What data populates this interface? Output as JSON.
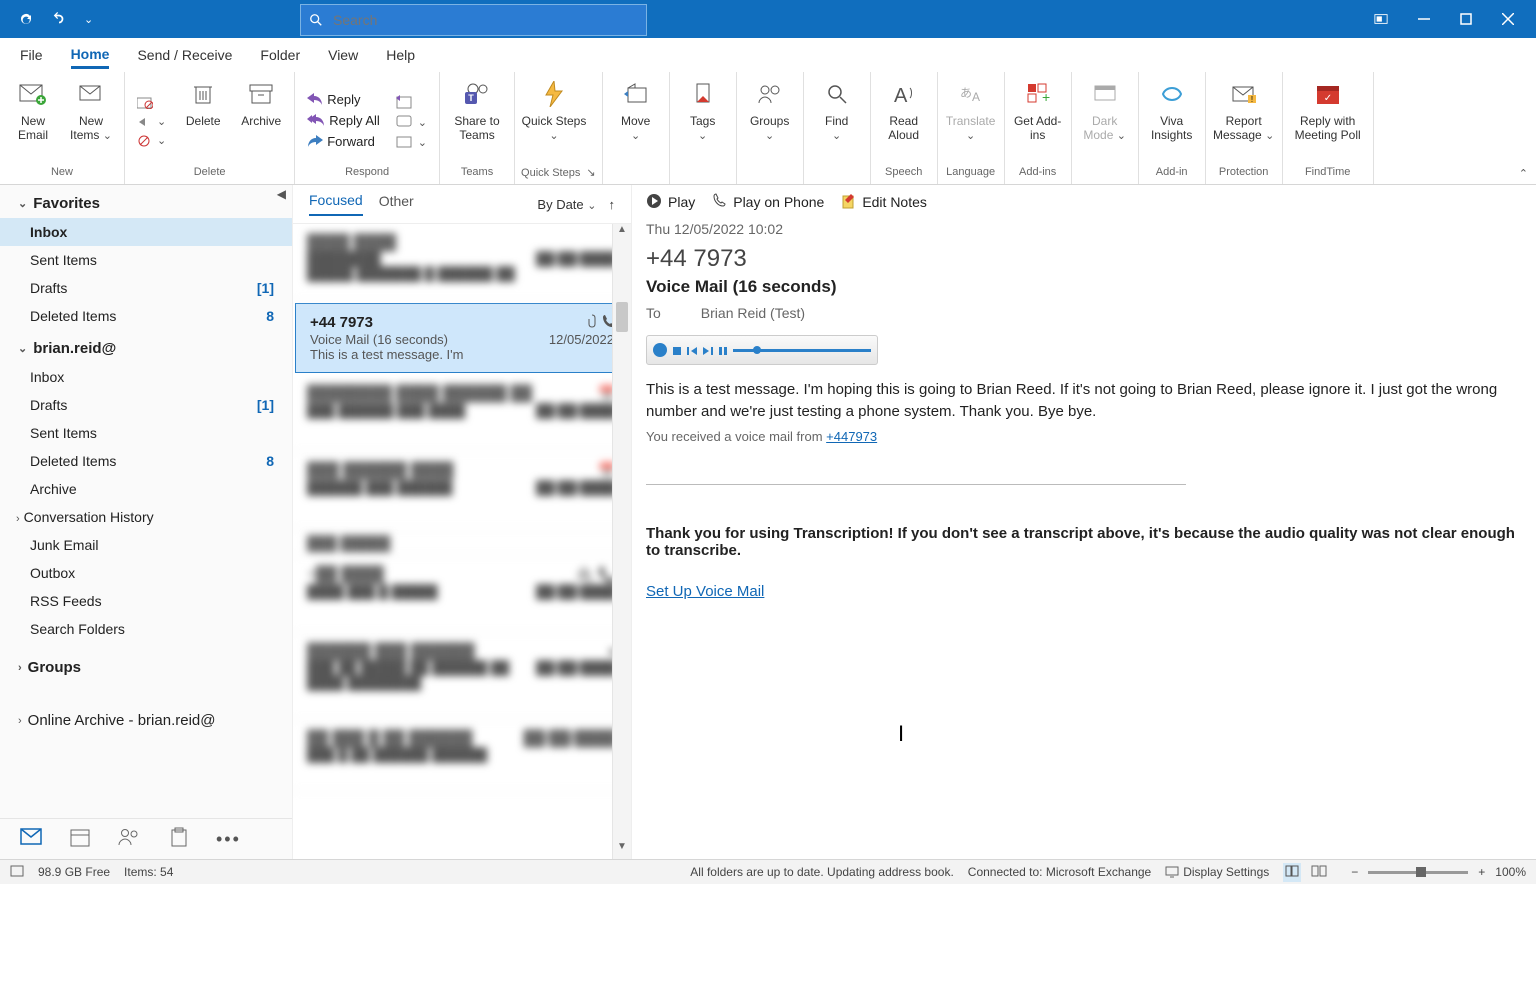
{
  "search_placeholder": "Search",
  "menu_tabs": [
    "File",
    "Home",
    "Send / Receive",
    "Folder",
    "View",
    "Help"
  ],
  "menu_active": "Home",
  "ribbon_groups": {
    "New": [
      "New Email",
      "New Items"
    ],
    "Delete": [
      "Delete",
      "Archive"
    ],
    "Respond": [
      "Reply",
      "Reply All",
      "Forward"
    ],
    "Teams": "Share to Teams",
    "QuickSteps": "Quick Steps",
    "Move": "Move",
    "Tags": "Tags",
    "Groups": "Groups",
    "Find": "Find",
    "Speech": "Read Aloud",
    "Language": "Translate",
    "Addins": "Get Add-ins",
    "Dark": "Dark Mode",
    "Addin": "Viva Insights",
    "Protection": "Report Message",
    "FindTime": "Reply with Meeting Poll"
  },
  "folders": {
    "favorites_label": "Favorites",
    "favorites": [
      {
        "name": "Inbox",
        "count": null,
        "selected": true
      },
      {
        "name": "Sent Items",
        "count": null
      },
      {
        "name": "Drafts",
        "count": "[1]"
      },
      {
        "name": "Deleted Items",
        "count": "8"
      }
    ],
    "account_label": "brian.reid@",
    "account_items": [
      {
        "name": "Inbox",
        "count": null
      },
      {
        "name": "Drafts",
        "count": "[1]"
      },
      {
        "name": "Sent Items",
        "count": null
      },
      {
        "name": "Deleted Items",
        "count": "8"
      },
      {
        "name": "Archive",
        "count": null
      },
      {
        "name": "Conversation History",
        "count": null,
        "expandable": true
      },
      {
        "name": "Junk Email",
        "count": null
      },
      {
        "name": "Outbox",
        "count": null
      },
      {
        "name": "RSS Feeds",
        "count": null
      },
      {
        "name": "Search Folders",
        "count": null
      }
    ],
    "groups_label": "Groups",
    "archive_label": "Online Archive - brian.reid@"
  },
  "msglist": {
    "tabs": [
      "Focused",
      "Other"
    ],
    "tabs_active": "Focused",
    "sort_label": "By Date",
    "selected": {
      "from": "+44 7973",
      "subject": "Voice Mail (16 seconds)",
      "preview": "This is a test message. I'm",
      "date": "12/05/2022",
      "hasAttach": true,
      "hasPhone": true
    }
  },
  "reading": {
    "toolbar": {
      "play": "Play",
      "play_on_phone": "Play on Phone",
      "edit_notes": "Edit Notes"
    },
    "datetime": "Thu 12/05/2022 10:02",
    "from": "+44 7973",
    "subject": "Voice Mail (16 seconds)",
    "to_label": "To",
    "to_value": "Brian Reid (Test)",
    "transcript": "This is a test message. I'm hoping this is going to Brian Reed. If it's not going to Brian Reed, please ignore it. I just got the wrong number and we're just testing a phone system. Thank you. Bye bye.",
    "source_prefix": "You received a voice mail from ",
    "source_number": "+447973",
    "thankyou": "Thank you for using Transcription! If you don't see a transcript above, it's because the audio quality was not clear enough to transcribe.",
    "setup_link": "Set Up Voice Mail"
  },
  "status": {
    "disk": "98.9 GB Free",
    "items": "Items: 54",
    "sync": "All folders are up to date.  Updating address book.",
    "connected": "Connected to: Microsoft Exchange",
    "display": "Display Settings",
    "zoom": "100%"
  }
}
